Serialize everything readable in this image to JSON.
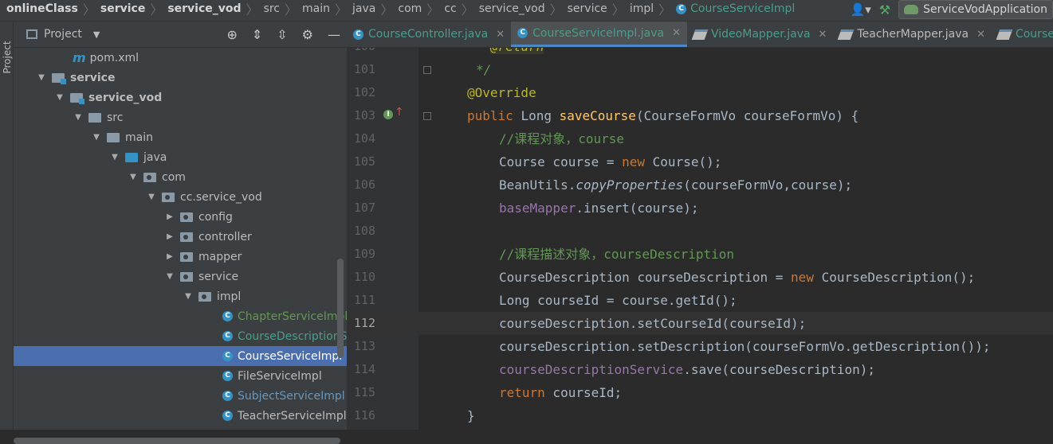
{
  "breadcrumb": {
    "items": [
      "onlineClass",
      "service",
      "service_vod",
      "src",
      "main",
      "java",
      "com",
      "cc",
      "service_vod",
      "service",
      "impl"
    ],
    "current": "CourseServiceImpl"
  },
  "toolbar": {
    "run_config": "ServiceVodApplication"
  },
  "sidebar": {
    "label": "Project"
  },
  "project": {
    "title": "Project",
    "tree": [
      {
        "label": "pom.xml"
      },
      {
        "label": "service"
      },
      {
        "label": "service_vod"
      },
      {
        "label": "src"
      },
      {
        "label": "main"
      },
      {
        "label": "java"
      },
      {
        "label": "com"
      },
      {
        "label": "cc.service_vod"
      },
      {
        "label": "config"
      },
      {
        "label": "controller"
      },
      {
        "label": "mapper"
      },
      {
        "label": "service"
      },
      {
        "label": "impl"
      },
      {
        "label": "ChapterServiceImpl"
      },
      {
        "label": "CourseDescriptionServiceImpl"
      },
      {
        "label": "CourseServiceImpl"
      },
      {
        "label": "FileServiceImpl"
      },
      {
        "label": "SubjectServiceImpl"
      },
      {
        "label": "TeacherServiceImpl"
      }
    ]
  },
  "tabs": [
    {
      "label": "CourseController.java"
    },
    {
      "label": "CourseServiceImpl.java"
    },
    {
      "label": "VideoMapper.java"
    },
    {
      "label": "TeacherMapper.java"
    },
    {
      "label": "CourseDescriptionService.java"
    }
  ],
  "code": {
    "line_numbers": [
      "100",
      "101",
      "102",
      "103",
      "104",
      "105",
      "106",
      "107",
      "108",
      "109",
      "110",
      "111",
      "112",
      "113",
      "114",
      "115",
      "116"
    ],
    "current_line": "112",
    "lines": {
      "l100": "@return",
      "l101": "*/",
      "l102": "@Override",
      "l103": {
        "kw": "public",
        "type": "Long",
        "name": "saveCourse",
        "params": "(CourseFormVo courseFormVo) {"
      },
      "l104": "//课程对象，course",
      "l105": {
        "a": "Course course = ",
        "kw": "new",
        "b": " Course();"
      },
      "l106": {
        "a": "BeanUtils.",
        "m": "copyProperties",
        "b": "(courseFormVo,course);"
      },
      "l107": {
        "f": "baseMapper",
        "b": ".insert(course);"
      },
      "l109": "//课程描述对象，courseDescription",
      "l110": {
        "a": "CourseDescription courseDescription = ",
        "kw": "new",
        "b": " CourseDescription();"
      },
      "l111": "Long courseId = course.getId();",
      "l112": "courseDescription.setCourseId(courseId);",
      "l113": "courseDescription.setDescription(courseFormVo.getDescription());",
      "l114": {
        "f": "courseDescriptionService",
        "b": ".save(courseDescription);"
      },
      "l115": {
        "kw": "return",
        "b": " courseId;"
      },
      "l116": "}"
    }
  },
  "colors": {
    "accent": "#4b6eaf",
    "keyword": "#cc7832",
    "annotation": "#bbb529",
    "method": "#ffc66d",
    "comment": "#629755",
    "field": "#9876aa"
  }
}
